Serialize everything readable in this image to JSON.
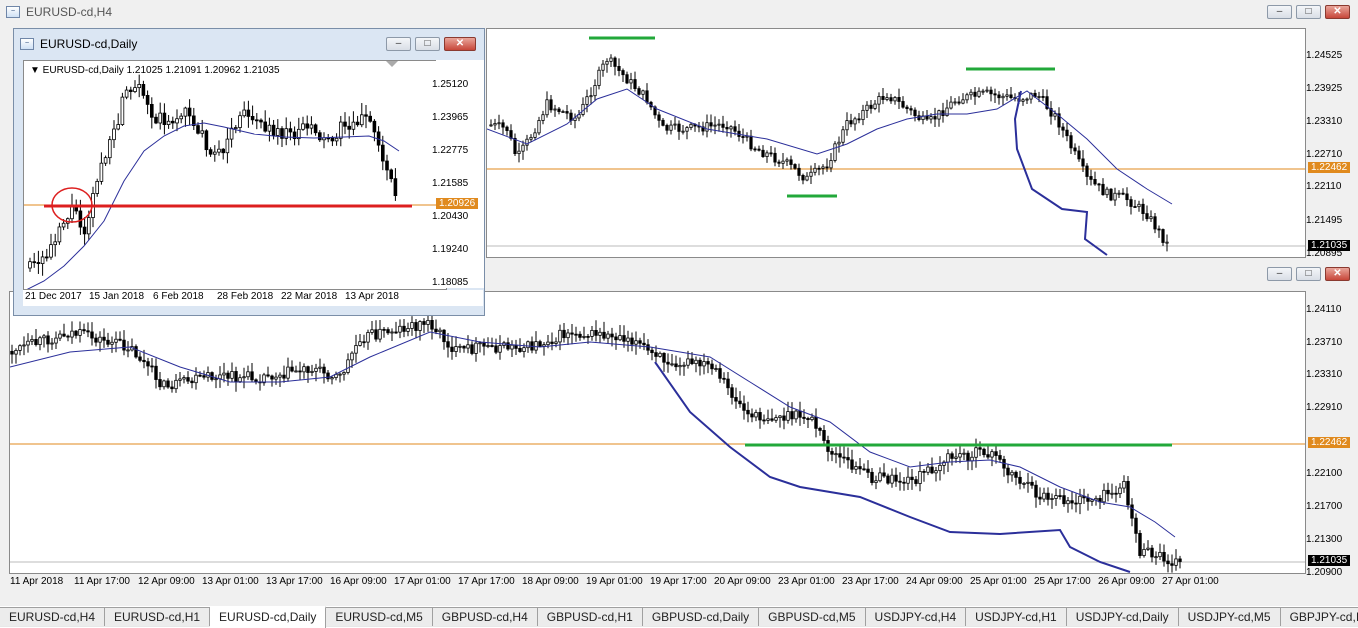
{
  "h4_window": {
    "title": "EURUSD-cd,H4",
    "prices": [
      "1.24525",
      "1.23925",
      "1.23310",
      "1.22710",
      "1.22110",
      "1.21495",
      "1.20895"
    ],
    "tags": {
      "orange": "1.22462",
      "current": "1.21035"
    }
  },
  "daily_window": {
    "title": "EURUSD-cd,Daily",
    "info": "▼ EURUSD-cd,Daily  1.21025 1.21091 1.20962 1.21035",
    "prices": [
      "1.25120",
      "1.23965",
      "1.22775",
      "1.21585",
      "1.20430",
      "1.19240",
      "1.18085"
    ],
    "tags": {
      "orange": "1.20926"
    },
    "dates": [
      "21 Dec 2017",
      "15 Jan 2018",
      "6 Feb 2018",
      "28 Feb 2018",
      "22 Mar 2018",
      "13 Apr 2018"
    ]
  },
  "h1_window": {
    "prices": [
      "1.24110",
      "1.23710",
      "1.23310",
      "1.22910",
      "1.22100",
      "1.21700",
      "1.21300",
      "1.20900"
    ],
    "tags": {
      "orange": "1.22462",
      "current": "1.21035"
    },
    "dates": [
      "11 Apr 2018",
      "11 Apr 17:00",
      "12 Apr 09:00",
      "13 Apr 01:00",
      "13 Apr 17:00",
      "16 Apr 09:00",
      "17 Apr 01:00",
      "17 Apr 17:00",
      "18 Apr 09:00",
      "19 Apr 01:00",
      "19 Apr 17:00",
      "20 Apr 09:00",
      "23 Apr 01:00",
      "23 Apr 17:00",
      "24 Apr 09:00",
      "25 Apr 01:00",
      "25 Apr 17:00",
      "26 Apr 09:00",
      "27 Apr 01:00"
    ]
  },
  "buttons": {
    "minimize": "–",
    "maximize": "□",
    "close": "✕"
  },
  "tabs": [
    "EURUSD-cd,H4",
    "EURUSD-cd,H1",
    "EURUSD-cd,Daily",
    "EURUSD-cd,M5",
    "GBPUSD-cd,H4",
    "GBPUSD-cd,H1",
    "GBPUSD-cd,Daily",
    "GBPUSD-cd,M5",
    "USDJPY-cd,H4",
    "USDJPY-cd,H1",
    "USDJPY-cd,Daily",
    "USDJPY-cd,M5",
    "GBPJPY-cd,I"
  ],
  "active_tab": 2,
  "colors": {
    "ma": "#2b2f9a",
    "level": "#e08a1e",
    "green": "#22a83a",
    "red": "#dd1f1f",
    "current_bg": "#000000"
  }
}
